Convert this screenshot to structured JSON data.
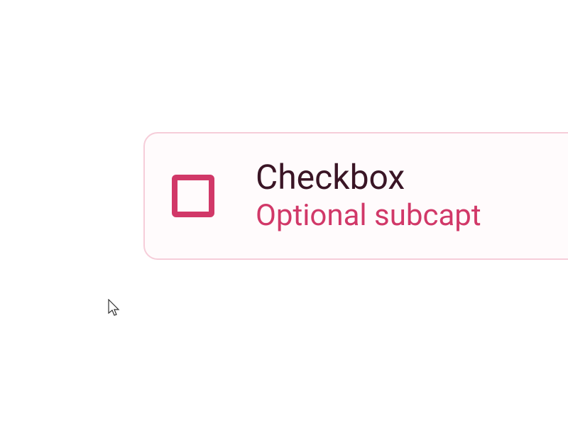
{
  "checkbox": {
    "title": "Checkbox",
    "subcaption": "Optional subcapt",
    "checked": false
  },
  "colors": {
    "accent": "#d13868",
    "border": "#f6cdd9",
    "text_dark": "#3a1525",
    "card_bg": "#fffbfc"
  }
}
